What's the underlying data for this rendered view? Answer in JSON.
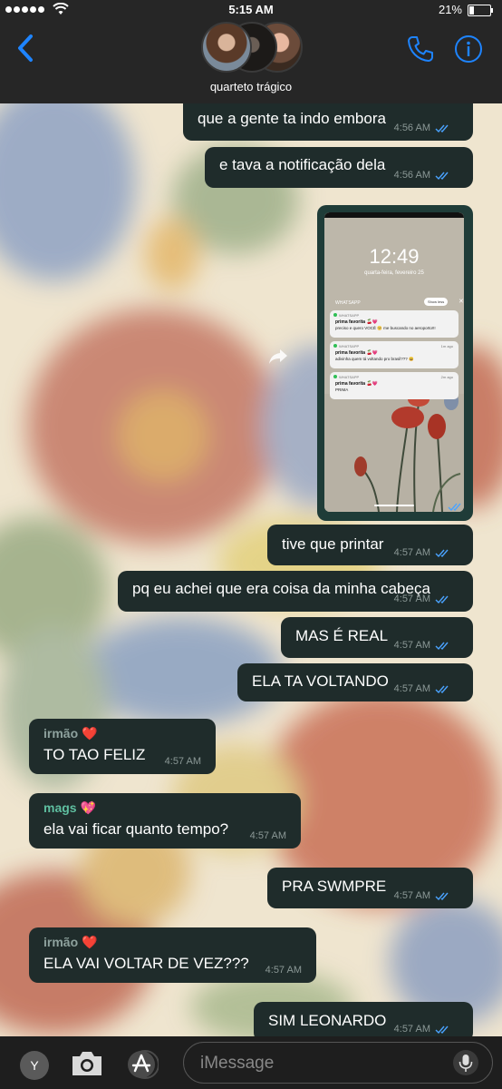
{
  "status": {
    "time": "5:15 AM",
    "battery": "21%"
  },
  "header": {
    "group_name": "quarteto trágico"
  },
  "messages": [
    {
      "text": "que a gente ta indo embora",
      "time": "4:56 AM"
    },
    {
      "text": "e tava a notificação dela",
      "time": "4:56 AM"
    },
    {
      "text": "tive que printar",
      "time": "4:57 AM"
    },
    {
      "text": "pq eu achei que era coisa da minha cabeça",
      "time": "4:57 AM"
    },
    {
      "text": "MAS É REAL",
      "time": "4:57 AM"
    },
    {
      "text": "ELA TA VOLTANDO",
      "time": "4:57 AM"
    },
    {
      "sender": "irmão ❤️",
      "text": "TO TAO FELIZ",
      "time": "4:57 AM"
    },
    {
      "sender": "mags 💖",
      "text": "ela vai ficar quanto tempo?",
      "time": "4:57 AM"
    },
    {
      "text": "PRA SWMPRE",
      "time": "4:57 AM"
    },
    {
      "sender": "irmão ❤️",
      "text": "ELA VAI VOLTAR DE VEZ???",
      "time": "4:57 AM"
    },
    {
      "text": "SIM LEONARDO",
      "time": "4:57 AM"
    }
  ],
  "screenshot": {
    "clock": "12:49",
    "date": "quarta-feira, fevereiro 25",
    "section": "WHATSAPP",
    "show_less": "Show less",
    "notifications": [
      {
        "app": "WHATSAPP",
        "ago": "",
        "title": "prima favorita 🍒💗",
        "text": "preciso e quero VOCÊ 🥺 me buscando no aeroporto!!!"
      },
      {
        "app": "WHATSAPP",
        "ago": "1m ago",
        "title": "prima favorita 🍒💗",
        "text": "adivinha quem tá voltando pro brasil??? 😆"
      },
      {
        "app": "WHATSAPP",
        "ago": "2m ago",
        "title": "prima favorita 🍒💗",
        "text": "PRIMA"
      }
    ]
  },
  "input": {
    "avatar_letter": "Y",
    "placeholder": "iMessage"
  },
  "colors": {
    "bubble": "#1f2c2b",
    "accent": "#1e84ff",
    "irmao": "#8ea29e",
    "mags": "#5fbfa0"
  }
}
